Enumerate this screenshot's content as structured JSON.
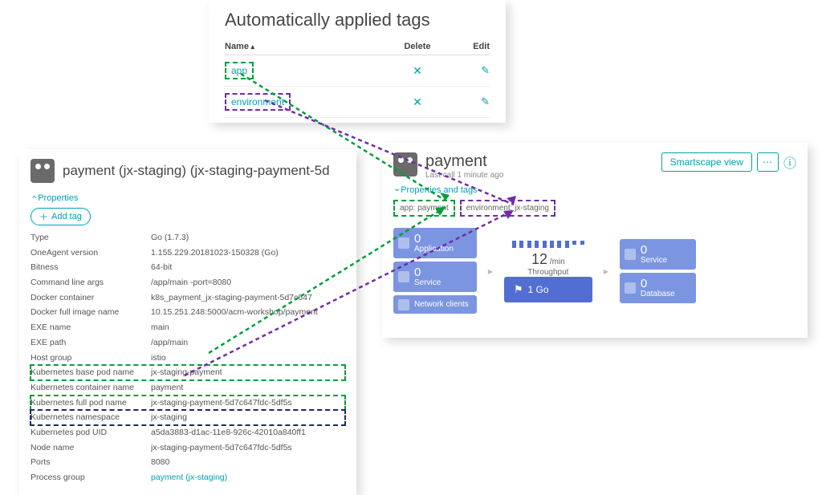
{
  "tags_panel": {
    "title": "Automatically applied tags",
    "header": {
      "name": "Name",
      "delete": "Delete",
      "edit": "Edit"
    },
    "rows": [
      {
        "name": "app"
      },
      {
        "name": "environment"
      }
    ]
  },
  "props_panel": {
    "title": "payment (jx-staging) (jx-staging-payment-5d",
    "section": "Properties",
    "add_tag": "Add tag",
    "rows": [
      {
        "key": "Type",
        "val": "Go (1.7.3)"
      },
      {
        "key": "OneAgent version",
        "val": "1.155.229.20181023-150328 (Go)"
      },
      {
        "key": "Bitness",
        "val": "64-bit"
      },
      {
        "key": "Command line args",
        "val": "/app/main -port=8080"
      },
      {
        "key": "Docker container",
        "val": "k8s_payment_jx-staging-payment-5d7c647"
      },
      {
        "key": "Docker full image name",
        "val": "10.15.251.248:5000/acm-workshop/payment"
      },
      {
        "key": "EXE name",
        "val": "main"
      },
      {
        "key": "EXE path",
        "val": "/app/main"
      },
      {
        "key": "Host group",
        "val": "istio"
      },
      {
        "key": "Kubernetes base pod name",
        "val": "jx-staging-payment"
      },
      {
        "key": "Kubernetes container name",
        "val": "payment"
      },
      {
        "key": "Kubernetes full pod name",
        "val": "jx-staging-payment-5d7c647fdc-5df5s"
      },
      {
        "key": "Kubernetes namespace",
        "val": "jx-staging"
      },
      {
        "key": "Kubernetes pod UID",
        "val": "a5da3883-d1ac-11e8-926c-42010a840ff1"
      },
      {
        "key": "Node name",
        "val": "jx-staging-payment-5d7c647fdc-5df5s"
      },
      {
        "key": "Ports",
        "val": "8080"
      },
      {
        "key": "Process group",
        "val": "payment (jx-staging)",
        "link": true
      }
    ]
  },
  "svc_panel": {
    "title": "payment",
    "subtitle": "Last call 1 minute ago",
    "smartscape": "Smartscape view",
    "section": "Properties and tags",
    "tag_app": "app: payment",
    "tag_env": "environment: jx-staging",
    "left_metrics": [
      {
        "num": "0",
        "label": "Application"
      },
      {
        "num": "0",
        "label": "Service"
      },
      {
        "num": "",
        "label": "Network clients"
      }
    ],
    "throughput_num": "12",
    "throughput_unit": "/min",
    "throughput_label": "Throughput",
    "main_box": "1 Go",
    "right_metrics": [
      {
        "num": "0",
        "label": "Service"
      },
      {
        "num": "0",
        "label": "Database"
      }
    ]
  }
}
